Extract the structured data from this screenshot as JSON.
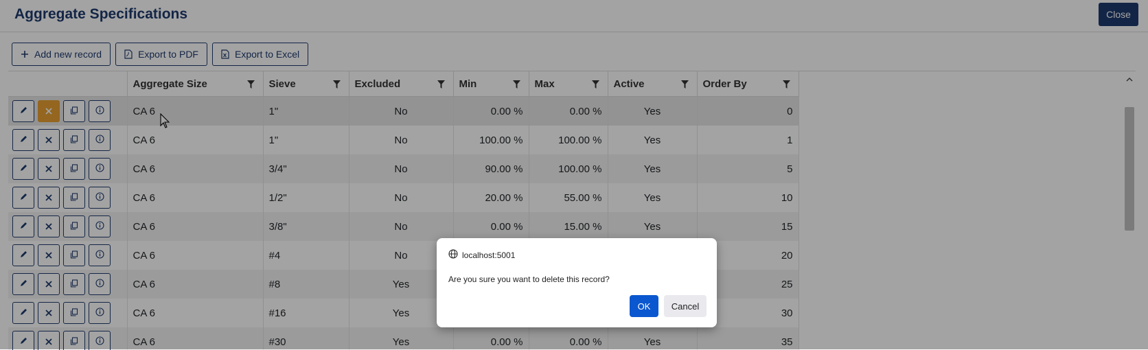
{
  "header": {
    "title": "Aggregate Specifications",
    "close_label": "Close"
  },
  "toolbar": {
    "add_label": "Add new record",
    "pdf_label": "Export to PDF",
    "excel_label": "Export to Excel"
  },
  "grid": {
    "columns": [
      "Aggregate Size",
      "Sieve",
      "Excluded",
      "Min",
      "Max",
      "Active",
      "Order By"
    ],
    "rows": [
      {
        "size": "CA 6",
        "sieve": "1\"",
        "excluded": "No",
        "min": "0.00 %",
        "max": "0.00 %",
        "active": "Yes",
        "order": "0"
      },
      {
        "size": "CA 6",
        "sieve": "1\"",
        "excluded": "No",
        "min": "100.00 %",
        "max": "100.00 %",
        "active": "Yes",
        "order": "1"
      },
      {
        "size": "CA 6",
        "sieve": "3/4\"",
        "excluded": "No",
        "min": "90.00 %",
        "max": "100.00 %",
        "active": "Yes",
        "order": "5"
      },
      {
        "size": "CA 6",
        "sieve": "1/2\"",
        "excluded": "No",
        "min": "20.00 %",
        "max": "55.00 %",
        "active": "Yes",
        "order": "10"
      },
      {
        "size": "CA 6",
        "sieve": "3/8\"",
        "excluded": "No",
        "min": "0.00 %",
        "max": "15.00 %",
        "active": "Yes",
        "order": "15"
      },
      {
        "size": "CA 6",
        "sieve": "#4",
        "excluded": "No",
        "min": "",
        "max": "",
        "active": "",
        "order": "20"
      },
      {
        "size": "CA 6",
        "sieve": "#8",
        "excluded": "Yes",
        "min": "",
        "max": "",
        "active": "",
        "order": "25"
      },
      {
        "size": "CA 6",
        "sieve": "#16",
        "excluded": "Yes",
        "min": "",
        "max": "",
        "active": "",
        "order": "30"
      },
      {
        "size": "CA 6",
        "sieve": "#30",
        "excluded": "Yes",
        "min": "0.00 %",
        "max": "0.00 %",
        "active": "Yes",
        "order": "35"
      }
    ]
  },
  "dialog": {
    "origin": "localhost:5001",
    "message": "Are you sure you want to delete this record?",
    "ok_label": "OK",
    "cancel_label": "Cancel"
  },
  "colors": {
    "primary": "#1f3a6e",
    "delete_active": "#e8a033",
    "dialog_ok": "#0b57d0"
  },
  "icons": [
    "plus-icon",
    "pdf-icon",
    "excel-icon",
    "filter-icon",
    "pencil-icon",
    "x-icon",
    "copy-icon",
    "info-icon",
    "globe-icon",
    "cursor-icon"
  ]
}
